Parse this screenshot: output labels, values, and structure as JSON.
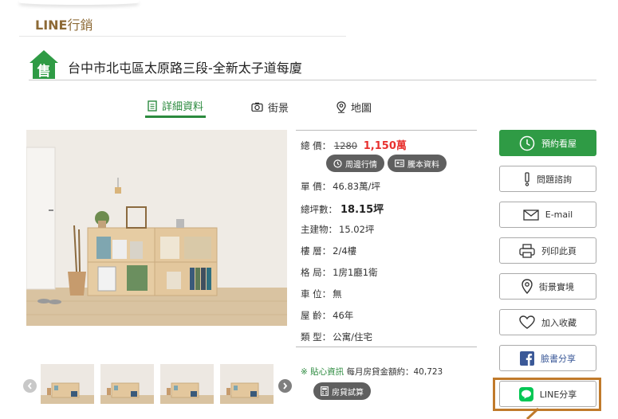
{
  "section": {
    "title_latin": "LINE",
    "title_cjk": "行銷"
  },
  "property": {
    "title": "台中市北屯區太原路三段-全新太子道每廈",
    "badge": "售"
  },
  "tabs": [
    {
      "label": "詳細資料",
      "icon": "document-icon",
      "active": true
    },
    {
      "label": "街景",
      "icon": "camera-icon",
      "active": false
    },
    {
      "label": "地圖",
      "icon": "map-pin-icon",
      "active": false
    }
  ],
  "details": {
    "total_price": {
      "label": "總 價：",
      "old": "1280",
      "current": "1,150萬"
    },
    "pills": [
      {
        "label": "周邊行情",
        "icon": "clock-icon"
      },
      {
        "label": "騰本資料",
        "icon": "id-card-icon"
      }
    ],
    "rows": [
      {
        "label": "單 價：",
        "value": "46.83萬/坪"
      },
      {
        "label": "總坪數：",
        "value": "18.15坪",
        "emphasis": true
      },
      {
        "label": "主建物：",
        "value": "15.02坪"
      },
      {
        "label": "樓 層：",
        "value": "2/4樓"
      },
      {
        "label": "格 局：",
        "value": "1房1廳1衛"
      },
      {
        "label": "車 位：",
        "value": "無"
      },
      {
        "label": "屋 齡：",
        "value": "46年"
      },
      {
        "label": "類 型：",
        "value": "公寓/住宅"
      }
    ]
  },
  "loan": {
    "icon_glyph": "※",
    "tip_label": "貼心資訊",
    "text": "每月房貸金額約：40,723",
    "button": "房貸試算"
  },
  "actions": [
    {
      "label": "預約看屋",
      "icon": "clock-icon",
      "primary": true
    },
    {
      "label": "問題諮詢",
      "icon": "exclamation-icon"
    },
    {
      "label": "E-mail",
      "icon": "envelope-icon"
    },
    {
      "label": "列印此頁",
      "icon": "printer-icon"
    },
    {
      "label": "街景實境",
      "icon": "map-pin-icon"
    },
    {
      "label": "加入收藏",
      "icon": "heart-icon"
    },
    {
      "label": "臉書分享",
      "icon": "facebook-icon"
    },
    {
      "label": "LINE分享",
      "icon": "line-icon"
    }
  ],
  "colors": {
    "brand_green": "#2f9b45",
    "price_red": "#e8312f",
    "highlight": "#c07a2b",
    "section_brown": "#8d6a36"
  }
}
